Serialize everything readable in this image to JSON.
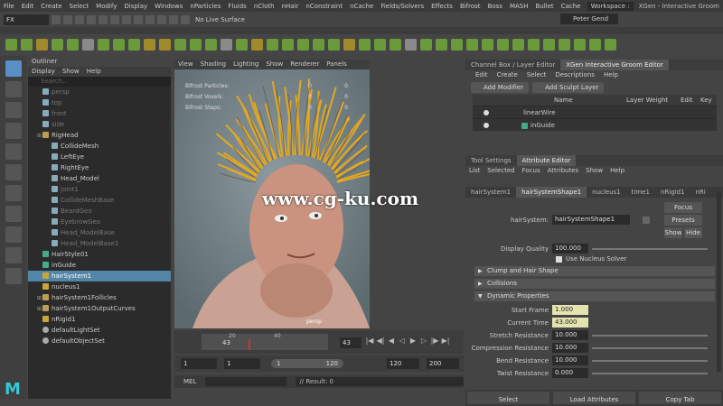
{
  "menubar": {
    "items": [
      "File",
      "Edit",
      "Create",
      "Select",
      "Modify",
      "Display",
      "Windows",
      "nParticles",
      "Fluids",
      "nCloth",
      "nHair",
      "nConstraint",
      "nCache",
      "Fields/Solvers",
      "Effects",
      "Bifrost",
      "Boss",
      "MASH",
      "Bullet",
      "Cache"
    ],
    "workspace_label": "Workspace :",
    "window_title": "XGen - Interactive Groom"
  },
  "status": {
    "mode": "FX",
    "live_surface": "No Live Surface",
    "user": "Peter Gend"
  },
  "outliner": {
    "title": "Outliner",
    "menu": [
      "Display",
      "Show",
      "Help"
    ],
    "search_placeholder": "Search...",
    "items": [
      {
        "label": "persp",
        "kind": "mesh",
        "indent": 1,
        "dim": true
      },
      {
        "label": "top",
        "kind": "mesh",
        "indent": 1,
        "dim": true
      },
      {
        "label": "front",
        "kind": "mesh",
        "indent": 1,
        "dim": true
      },
      {
        "label": "side",
        "kind": "mesh",
        "indent": 1,
        "dim": true
      },
      {
        "label": "RigHead",
        "kind": "grp",
        "indent": 1,
        "dim": false
      },
      {
        "label": "CollideMesh",
        "kind": "mesh",
        "indent": 2,
        "dim": false
      },
      {
        "label": "LeftEye",
        "kind": "mesh",
        "indent": 2,
        "dim": false
      },
      {
        "label": "RightEye",
        "kind": "mesh",
        "indent": 2,
        "dim": false
      },
      {
        "label": "Head_Model",
        "kind": "mesh",
        "indent": 2,
        "dim": false
      },
      {
        "label": "joint1",
        "kind": "mesh",
        "indent": 2,
        "dim": true
      },
      {
        "label": "CollideMeshBase",
        "kind": "mesh",
        "indent": 2,
        "dim": true
      },
      {
        "label": "BeardGeo",
        "kind": "mesh",
        "indent": 2,
        "dim": true
      },
      {
        "label": "EyebrowGeo",
        "kind": "mesh",
        "indent": 2,
        "dim": true
      },
      {
        "label": "Head_ModelBase",
        "kind": "mesh",
        "indent": 2,
        "dim": true
      },
      {
        "label": "Head_ModelBase1",
        "kind": "mesh",
        "indent": 2,
        "dim": true
      },
      {
        "label": "HairStyle01",
        "kind": "xg",
        "indent": 1,
        "dim": false
      },
      {
        "label": "inGuide",
        "kind": "xg",
        "indent": 1,
        "dim": false
      },
      {
        "label": "hairSystem1",
        "kind": "hair",
        "indent": 1,
        "dim": false,
        "selected": true
      },
      {
        "label": "nucleus1",
        "kind": "hair",
        "indent": 1,
        "dim": false
      },
      {
        "label": "hairSystem1Follicles",
        "kind": "grp",
        "indent": 1,
        "dim": false
      },
      {
        "label": "hairSystem1OutputCurves",
        "kind": "grp",
        "indent": 1,
        "dim": false
      },
      {
        "label": "nRigid1",
        "kind": "hair",
        "indent": 1,
        "dim": false
      },
      {
        "label": "defaultLightSet",
        "kind": "set",
        "indent": 1,
        "dim": false
      },
      {
        "label": "defaultObjectSet",
        "kind": "set",
        "indent": 1,
        "dim": false
      }
    ]
  },
  "viewport": {
    "menu": [
      "View",
      "Shading",
      "Lighting",
      "Show",
      "Renderer",
      "Panels"
    ],
    "hud": [
      {
        "label": "Bifrost Particles:",
        "a": "0",
        "b": "0"
      },
      {
        "label": "Bifrost Voxels:",
        "a": "0",
        "b": "0"
      },
      {
        "label": "Bifrost Steps:",
        "a": "0",
        "b": "0"
      }
    ],
    "camera": "persp",
    "watermark": "www.cg-ku.com"
  },
  "timeline": {
    "ticks": [
      "20",
      "40"
    ],
    "current_frame": "43",
    "frame_field": "43",
    "range": {
      "start": "1",
      "inner_start": "1",
      "bar_start": "1",
      "bar_end": "120",
      "end": "120",
      "anim_end": "200"
    }
  },
  "cmd": {
    "mel": "MEL",
    "result": "// Result: 0"
  },
  "channelbox": {
    "tabs": [
      "Channel Box / Layer Editor",
      "XGen Interactive Groom Editor"
    ],
    "menu": [
      "Edit",
      "Create",
      "Select",
      "Descriptions",
      "Help"
    ],
    "add_modifier": "Add Modifier",
    "add_sculpt": "Add Sculpt Layer",
    "layer_cols": {
      "name": "Name",
      "weight": "Layer Weight",
      "edit": "Edit",
      "key": "Key"
    },
    "layers": [
      {
        "label": "linearWire"
      },
      {
        "label": "inGuide"
      }
    ]
  },
  "attr": {
    "tabs": [
      "Tool Settings",
      "Attribute Editor"
    ],
    "menu": [
      "List",
      "Selected",
      "Focus",
      "Attributes",
      "Show",
      "Help"
    ],
    "node_tabs": [
      "hairSystem1",
      "hairSystemShape1",
      "nucleus1",
      "time1",
      "nRigid1",
      "nRi"
    ],
    "node_label": "hairSystem:",
    "node_value": "hairSystemShape1",
    "focus": "Focus",
    "presets": "Presets",
    "show": "Show",
    "hide": "Hide",
    "display_quality_label": "Display Quality",
    "display_quality": "100.000",
    "use_nucleus": "Use Nucleus Solver",
    "sections": [
      "Clump and Hair Shape",
      "Collisions",
      "Dynamic Properties"
    ],
    "fields": [
      {
        "label": "Start Frame",
        "value": "1.000",
        "hl": true
      },
      {
        "label": "Current Time",
        "value": "43.000",
        "hl": true
      },
      {
        "label": "Stretch Resistance",
        "value": "10.000",
        "hl": false
      },
      {
        "label": "Compression Resistance",
        "value": "10.000",
        "hl": false
      },
      {
        "label": "Bend Resistance",
        "value": "10.000",
        "hl": false
      },
      {
        "label": "Twist Resistance",
        "value": "0.000",
        "hl": false
      }
    ],
    "bottom": [
      "Select",
      "Load Attributes",
      "Copy Tab"
    ]
  }
}
